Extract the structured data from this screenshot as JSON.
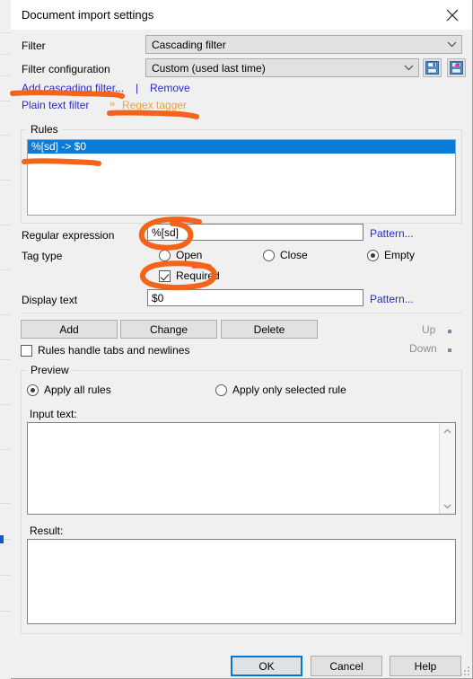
{
  "window": {
    "title": "Document import settings",
    "close_icon": "close-icon"
  },
  "form": {
    "filter_label": "Filter",
    "filter_value": "Cascading filter",
    "filter_config_label": "Filter configuration",
    "filter_config_value": "Custom (used last time)",
    "save_icon": "floppy-disk-save-icon",
    "save_as_icon": "floppy-disk-save-as-icon"
  },
  "links": {
    "add_cascading_filter": "Add cascading filter...",
    "separator": "|",
    "remove": "Remove"
  },
  "breadcrumb": {
    "first": "Plain text filter",
    "arrow": "»",
    "active": "Regex tagger"
  },
  "rules": {
    "group_title": "Rules",
    "items": [
      "%[sd] -> $0"
    ],
    "selected_index": 0
  },
  "fields": {
    "regex_label": "Regular expression",
    "regex_value": "%[sd]",
    "regex_pattern_link": "Pattern...",
    "tag_type_label": "Tag type",
    "tag_type_options": [
      "Open",
      "Close",
      "Empty"
    ],
    "tag_type_selected": "Empty",
    "required_label": "Required",
    "required_checked": true,
    "display_text_label": "Display text",
    "display_text_value": "$0",
    "display_text_pattern_link": "Pattern..."
  },
  "actions": {
    "add": "Add",
    "change": "Change",
    "delete": "Delete",
    "up": "Up",
    "down": "Down",
    "tabs_newlines_label": "Rules handle tabs and newlines",
    "tabs_newlines_checked": false
  },
  "preview": {
    "group_title": "Preview",
    "apply_all_label": "Apply all rules",
    "apply_selected_label": "Apply only selected rule",
    "apply_selected_value": "Apply all rules",
    "input_text_label": "Input text:",
    "input_text_value": "",
    "result_label": "Result:",
    "result_value": ""
  },
  "footer": {
    "ok": "OK",
    "cancel": "Cancel",
    "help": "Help"
  },
  "colors": {
    "accent_blue": "#0078d7",
    "selection_blue": "#0a7bd6",
    "link_blue": "#2a2ad0",
    "breadcrumb_orange": "#e8a33d",
    "annotation_orange": "#f4631a",
    "dialog_bg": "#f0f0f0"
  }
}
